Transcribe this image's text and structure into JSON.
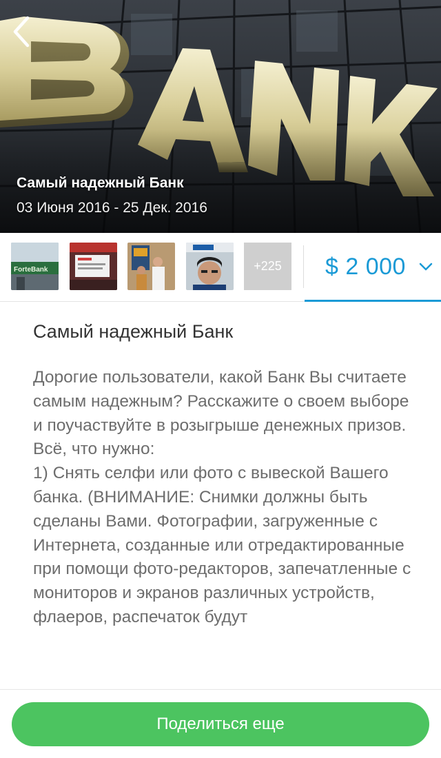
{
  "hero": {
    "sign_text": "BANK",
    "title": "Самый надежный Банк",
    "dates": "03 Июня 2016 - 25 Дек. 2016",
    "back_icon": "chevron-left-icon"
  },
  "thumbnails": {
    "thumb_1_sign": "ForteBank",
    "more_label": "+225"
  },
  "prize": {
    "amount": "$ 2 000",
    "dropdown_icon": "chevron-down-icon",
    "accent_color": "#1a9ad6"
  },
  "content": {
    "title": "Самый надежный Банк",
    "paragraphs": [
      "Дорогие пользователи,  какой Банк Вы считаете самым надежным? Расскажите о своем выборе и поучаствуйте в розыгрыше денежных призов. Всё, что нужно:",
      "1) Снять селфи или фото с вывеской Вашего банка. (ВНИМАНИЕ: Снимки должны быть сделаны Вами. Фотографии, загруженные с Интернета, созданные или отредактированные при помощи фото-редакторов, запечатленные с мониторов и экранов различных устройств, флаеров, распечаток будут"
    ]
  },
  "footer": {
    "share_label": "Поделиться еще",
    "button_color": "#4cc460"
  }
}
